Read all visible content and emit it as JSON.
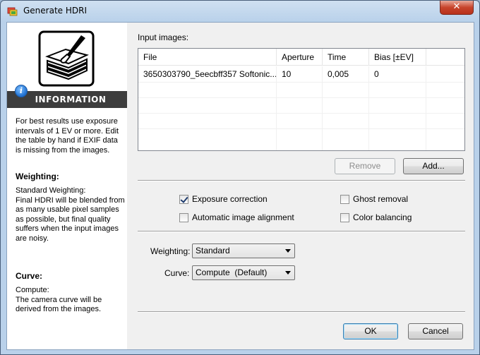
{
  "window": {
    "title": "Generate HDRI",
    "close_glyph": "✕"
  },
  "sidebar": {
    "info_heading": "INFORMATION",
    "info_icon_glyph": "i",
    "intro_text": "For best results use exposure intervals of 1 EV or more. Edit the table by hand if EXIF data is missing from the images.",
    "weighting_heading": "Weighting:",
    "weighting_text": "Standard Weighting:\nFinal HDRI will be blended from as many usable pixel samples as possible, but final quality suffers when the input images are noisy.",
    "curve_heading": "Curve:",
    "curve_text": "Compute:\nThe camera curve will be derived from the images."
  },
  "input_images": {
    "label": "Input images:",
    "columns": [
      "File",
      "Aperture",
      "Time",
      "Bias [±EV]"
    ],
    "rows": [
      {
        "file": "3650303790_5eecbff357 Softonic...",
        "aperture": "10",
        "time": "0,005",
        "bias": "0"
      }
    ]
  },
  "buttons": {
    "remove": "Remove",
    "add": "Add...",
    "ok": "OK",
    "cancel": "Cancel"
  },
  "options": {
    "exposure_correction": {
      "label": "Exposure correction",
      "checked": true
    },
    "ghost_removal": {
      "label": "Ghost removal",
      "checked": false
    },
    "automatic_alignment": {
      "label": "Automatic image alignment",
      "checked": false
    },
    "color_balancing": {
      "label": "Color balancing",
      "checked": false
    }
  },
  "weighting": {
    "label": "Weighting:",
    "value": "Standard"
  },
  "curve": {
    "label": "Curve:",
    "value": "Compute  (Default)"
  },
  "colors": {
    "title_bar": "#b9d1ea",
    "info_banner": "#3d3d3d",
    "info_icon": "#1f6fd0"
  }
}
